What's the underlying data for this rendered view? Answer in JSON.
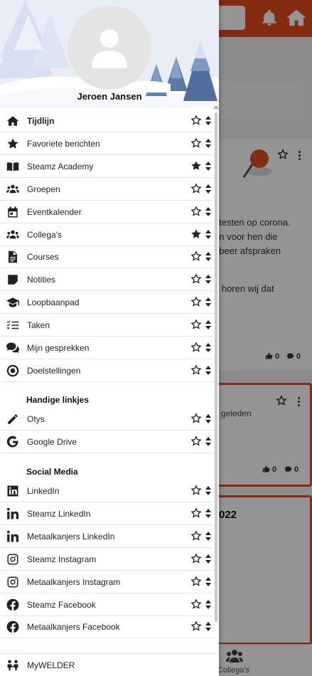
{
  "user": {
    "name": "Jeroen Jansen"
  },
  "menu": {
    "items": [
      {
        "label": "Tijdlijn",
        "icon": "home-icon",
        "starred": false,
        "bold": true
      },
      {
        "label": "Favoriete berichten",
        "icon": "star-solid-icon",
        "starred": false
      },
      {
        "label": "Steamz Academy",
        "icon": "book-icon",
        "starred": true
      },
      {
        "label": "Groepen",
        "icon": "users-icon",
        "starred": false
      },
      {
        "label": "Eventkalender",
        "icon": "calendar-icon",
        "starred": false
      },
      {
        "label": "Collega's",
        "icon": "users-icon",
        "starred": true
      },
      {
        "label": "Courses",
        "icon": "file-icon",
        "starred": false
      },
      {
        "label": "Notities",
        "icon": "note-icon",
        "starred": false
      },
      {
        "label": "Loopbaanpad",
        "icon": "graduation-cap-icon",
        "starred": false
      },
      {
        "label": "Taken",
        "icon": "task-list-icon",
        "starred": false
      },
      {
        "label": "Mijn gesprekken",
        "icon": "chat-icon",
        "starred": false
      },
      {
        "label": "Doelstellingen",
        "icon": "target-icon",
        "starred": false
      }
    ]
  },
  "handy_links": {
    "title": "Handige linkjes",
    "items": [
      {
        "label": "Otys",
        "icon": "pencil-icon"
      },
      {
        "label": "Google Drive",
        "icon": "google-icon"
      }
    ]
  },
  "social_media": {
    "title": "Social Media",
    "items": [
      {
        "label": "LinkedIn",
        "icon": "linkedin-square-icon"
      },
      {
        "label": "Steamz LinkedIn",
        "icon": "linkedin-icon"
      },
      {
        "label": "Metaalkanjers LinkedIn",
        "icon": "linkedin-icon"
      },
      {
        "label": "Steamz Instagram",
        "icon": "instagram-icon"
      },
      {
        "label": "Metaalkanjers Instagram",
        "icon": "instagram-icon"
      },
      {
        "label": "Steamz Facebook",
        "icon": "facebook-icon"
      },
      {
        "label": "Metaalkanjers Facebook",
        "icon": "facebook-icon"
      }
    ]
  },
  "footer_item": {
    "label": "MyWELDER",
    "icon": "welder-icon"
  },
  "background": {
    "post1": {
      "line1": "f testen op corona.",
      "line2": "en voor hen die",
      "line3": "obeer afspraken",
      "line4": "n horen wij dat",
      "likes": "0",
      "comments": "0"
    },
    "post2": {
      "time": "geleden",
      "likes": "0",
      "comments": "0"
    },
    "post3": {
      "title_fragment": "022"
    },
    "bottom_nav": {
      "colleagues_label": "Collega's"
    }
  },
  "colors": {
    "accent": "#e34a1f",
    "text": "#222222"
  }
}
